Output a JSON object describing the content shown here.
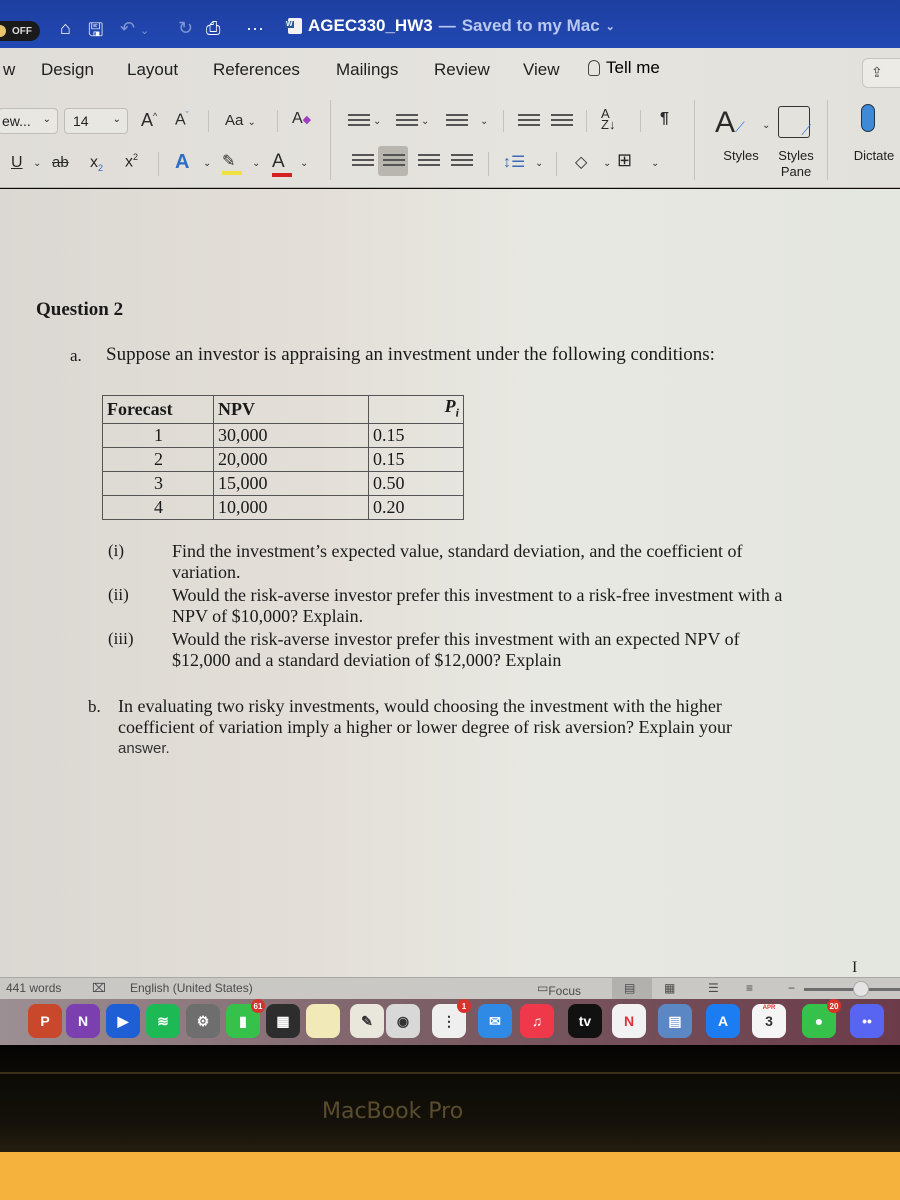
{
  "titlebar": {
    "autosave_label": "OFF",
    "doc_name": "AGEC330_HW3",
    "separator": "—",
    "save_status": "Saved to my Mac",
    "icons": [
      "home-icon",
      "save-icon",
      "undo-icon",
      "redo-icon",
      "print-icon",
      "more-icon"
    ]
  },
  "ribbon": {
    "tabs": [
      {
        "label": "w"
      },
      {
        "label": "Design"
      },
      {
        "label": "Layout"
      },
      {
        "label": "References"
      },
      {
        "label": "Mailings"
      },
      {
        "label": "Review"
      },
      {
        "label": "View"
      }
    ],
    "tell_me": "Tell me",
    "font_name": "ew...",
    "font_size": "14",
    "change_case": "Aa",
    "styles_label": "Styles",
    "styles_pane_label": "Styles Pane",
    "dictate_label": "Dictate",
    "highlight_color": "#f0e040",
    "font_color": "#d42020"
  },
  "document": {
    "question_title": "Question 2",
    "part_a_label": "a.",
    "part_a_text": "Suppose an investor is appraising an investment under the following conditions:",
    "table": {
      "headers": [
        "Forecast",
        "NPV",
        "Pi"
      ],
      "rows": [
        [
          "1",
          "30,000",
          "0.15"
        ],
        [
          "2",
          "20,000",
          "0.15"
        ],
        [
          "3",
          "15,000",
          "0.50"
        ],
        [
          "4",
          "10,000",
          "0.20"
        ]
      ]
    },
    "sub_items": [
      {
        "num": "(i)",
        "line1": "Find the investment’s expected value, standard deviation, and the coefficient of",
        "line2": "variation."
      },
      {
        "num": "(ii)",
        "line1": "Would the risk-averse investor prefer this investment to a risk-free investment with a",
        "line2": "NPV of $10,000? Explain."
      },
      {
        "num": "(iii)",
        "line1": "Would the risk-averse investor prefer this investment with an expected NPV of",
        "line2": "$12,000 and a standard deviation of $12,000? Explain"
      }
    ],
    "part_b_label": "b.",
    "part_b_line1": "In evaluating two risky investments, would choosing the investment with the higher",
    "part_b_line2": "coefficient of variation imply a higher or lower degree of risk aversion? Explain your",
    "part_b_line3": "answer."
  },
  "statusbar": {
    "word_count": "441 words",
    "language": "English (United States)",
    "focus_label": "Focus"
  },
  "dock": {
    "apps": [
      {
        "name": "PowerPoint",
        "glyph": "P",
        "color": "#c9472a"
      },
      {
        "name": "OneNote",
        "glyph": "N",
        "color": "#7b3fb0"
      },
      {
        "name": "Zoom",
        "glyph": "▶",
        "color": "#1f5fd6"
      },
      {
        "name": "Spotify",
        "glyph": "≋",
        "color": "#1db954"
      },
      {
        "name": "System Preferences",
        "glyph": "⚙",
        "color": "#6e6e6e"
      },
      {
        "name": "FaceTime",
        "glyph": "▮",
        "color": "#35c14a",
        "badge": "61"
      },
      {
        "name": "Calculator",
        "glyph": "▦",
        "color": "#2d2d2d"
      },
      {
        "name": "Notes",
        "glyph": "",
        "color": "#f1e9b8"
      },
      {
        "name": "TextEdit",
        "glyph": "✎",
        "color": "#e9e6dc"
      },
      {
        "name": "Screenshot",
        "glyph": "◉",
        "color": "#d8d8d8"
      },
      {
        "name": "Reminders",
        "glyph": "⋮",
        "color": "#efefef",
        "badge": "1"
      },
      {
        "name": "Mail",
        "glyph": "✉",
        "color": "#2f8ae5"
      },
      {
        "name": "Music",
        "glyph": "♫",
        "color": "#f0384b"
      },
      {
        "name": "TV",
        "glyph": "tv",
        "color": "#111111"
      },
      {
        "name": "News",
        "glyph": "N",
        "color": "#f2f2f2"
      },
      {
        "name": "Preview",
        "glyph": "▤",
        "color": "#5c87c5"
      },
      {
        "name": "App Store",
        "glyph": "A",
        "color": "#1c7cf2"
      },
      {
        "name": "Calendar",
        "glyph": "3",
        "month": "APR",
        "color": "#f5f5f5"
      },
      {
        "name": "Messages",
        "glyph": "●",
        "color": "#35c14a",
        "badge": "20"
      },
      {
        "name": "Discord",
        "glyph": "••",
        "color": "#5865f2"
      }
    ]
  },
  "hardware": {
    "bezel_label": "MacBook Pro"
  }
}
